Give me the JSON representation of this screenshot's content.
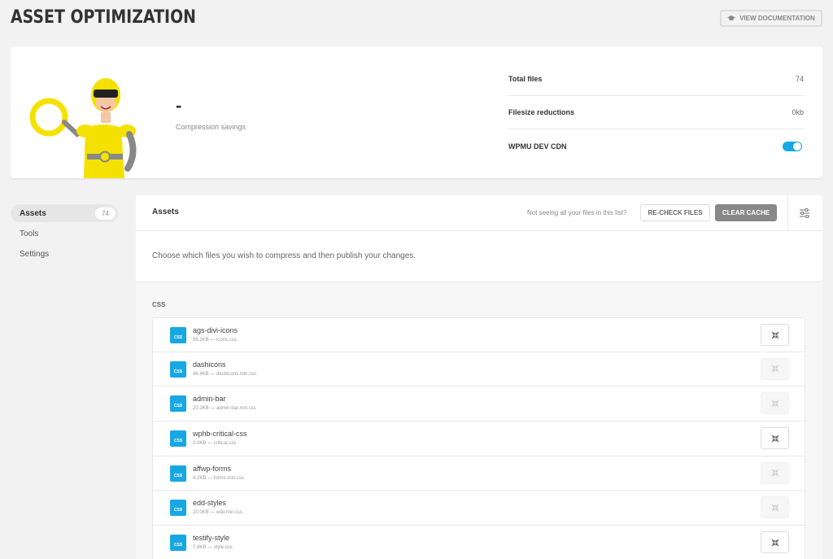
{
  "header": {
    "title": "ASSET OPTIMIZATION",
    "doc_button": "VIEW DOCUMENTATION"
  },
  "summary": {
    "compression_value": "-",
    "compression_label": "Compression savings",
    "stats": [
      {
        "label": "Total files",
        "value": "74"
      },
      {
        "label": "Filesize reductions",
        "value": "0kb"
      },
      {
        "label": "WPMU DEV CDN",
        "value": ""
      }
    ],
    "cdn_enabled": true
  },
  "sidebar": {
    "items": [
      {
        "label": "Assets",
        "count": "74",
        "active": true
      },
      {
        "label": "Tools",
        "count": "",
        "active": false
      },
      {
        "label": "Settings",
        "count": "",
        "active": false
      }
    ]
  },
  "panel": {
    "title": "Assets",
    "hint": "Not seeing all your files in this list?",
    "recheck_label": "RE-CHECK FILES",
    "clear_cache_label": "CLEAR CACHE",
    "intro": "Choose which files you wish to compress and then publish your changes.",
    "section_label": "CSS",
    "files": [
      {
        "name": "ags-divi-icons",
        "meta": "56.2KB — icons.css",
        "type": "CSS",
        "enabled": true
      },
      {
        "name": "dashicons",
        "meta": "46.4KB — dashicons.min.css",
        "type": "CSS",
        "enabled": false
      },
      {
        "name": "admin-bar",
        "meta": "20.2KB — admin-bar.min.css",
        "type": "CSS",
        "enabled": false
      },
      {
        "name": "wphb-critical-css",
        "meta": "0.0KB — critical.css",
        "type": "CSS",
        "enabled": true
      },
      {
        "name": "affwp-forms",
        "meta": "4.2KB — forms.min.css",
        "type": "CSS",
        "enabled": false
      },
      {
        "name": "edd-styles",
        "meta": "20.0KB — edd.min.css",
        "type": "CSS",
        "enabled": false
      },
      {
        "name": "testify-style",
        "meta": "7.8KB — style.css",
        "type": "CSS",
        "enabled": true
      }
    ]
  },
  "colors": {
    "accent": "#17a8e3",
    "mascot_yellow": "#f5e100"
  },
  "icons": {
    "doc_button": "graduation-cap-icon",
    "filter": "filter-sliders-icon",
    "compress": "compress-arrows-icon"
  }
}
